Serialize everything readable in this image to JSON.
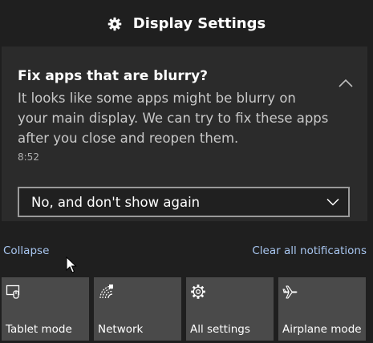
{
  "header": {
    "title": "Display Settings",
    "icon": "gear-icon"
  },
  "notification": {
    "title": "Fix apps that are blurry?",
    "body_lines": [
      "It looks like some apps might be blurry on",
      "your main display. We can try to fix these apps",
      "after you close and reopen them."
    ],
    "time": "8:52",
    "selected_option": "No, and don't show again"
  },
  "links": {
    "collapse": "Collapse",
    "clear_all": "Clear all notifications"
  },
  "quick_actions": [
    {
      "label": "Tablet mode",
      "icon": "tablet-mode-icon"
    },
    {
      "label": "Network",
      "icon": "network-icon"
    },
    {
      "label": "All settings",
      "icon": "gear-icon"
    },
    {
      "label": "Airplane mode",
      "icon": "airplane-icon"
    }
  ],
  "colors": {
    "background": "#1f1f1f",
    "card": "#2b2b2b",
    "tile": "#4a4a4a",
    "link": "#a8c6f0"
  }
}
